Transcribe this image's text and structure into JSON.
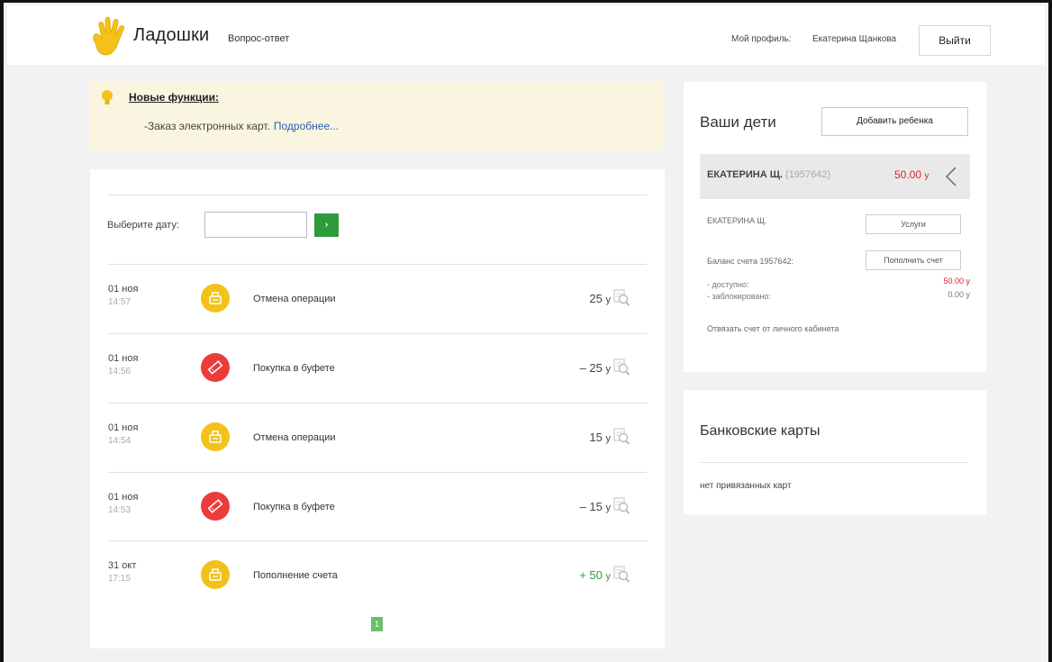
{
  "header": {
    "brand": "Ладошки",
    "nav_qa": "Вопрос-ответ",
    "profile_label": "Мой профиль:",
    "profile_name": "Екатерина Щанкова",
    "logout": "Выйти"
  },
  "notice": {
    "title": "Новые функции:",
    "text": "-Заказ электронных карт.",
    "link": "Подробнее..."
  },
  "operations": {
    "date_label": "Выберите дату:",
    "date_value": "",
    "go_label": "›",
    "rows": [
      {
        "date": "01 ноя",
        "time": "14:57",
        "icon": "receipt-icon",
        "color": "#f2c21b",
        "title": "Отмена операции",
        "amount": "25",
        "currency": "у",
        "kind": "neutral"
      },
      {
        "date": "01 ноя",
        "time": "14:56",
        "icon": "ticket-icon",
        "color": "#ec3b3b",
        "title": "Покупка в буфете",
        "amount": "– 25",
        "currency": "у",
        "kind": "neutral"
      },
      {
        "date": "01 ноя",
        "time": "14:54",
        "icon": "receipt-icon",
        "color": "#f2c21b",
        "title": "Отмена операции",
        "amount": "15",
        "currency": "у",
        "kind": "neutral"
      },
      {
        "date": "01 ноя",
        "time": "14:53",
        "icon": "ticket-icon",
        "color": "#ec3b3b",
        "title": "Покупка в буфете",
        "amount": "– 15",
        "currency": "у",
        "kind": "neutral"
      },
      {
        "date": "31 окт",
        "time": "17:15",
        "icon": "receipt-icon",
        "color": "#f2c21b",
        "title": "Пополнение счета",
        "amount": "+ 50",
        "currency": "у",
        "kind": "positive"
      }
    ],
    "page": "1"
  },
  "children": {
    "title": "Ваши дети",
    "add_button": "Добавить ребенка",
    "child": {
      "name": "ЕКАТЕРИНА Щ.",
      "id": "(1957642)",
      "balance": "50.00",
      "currency": "у",
      "sub_name": "ЕКАТЕРИНА Щ.",
      "services_button": "Услуги",
      "account_label": "Баланс счета 1957642:",
      "topup_button": "Пополнить счет",
      "available_label": "- доступно:",
      "available_value": "50.00 у",
      "blocked_label": "- заблокировано:",
      "blocked_value": "0.00 у",
      "unlink": "Отвязать счет от личного кабинета"
    }
  },
  "bank_cards": {
    "title": "Банковские карты",
    "empty": "нет привязанных карт"
  },
  "colors": {
    "accent_green": "#2e9b3c",
    "negative_red": "#d9232d",
    "notice_bg": "#faf5e0",
    "icon_yellow": "#f2c21b",
    "icon_red": "#ec3b3b"
  }
}
